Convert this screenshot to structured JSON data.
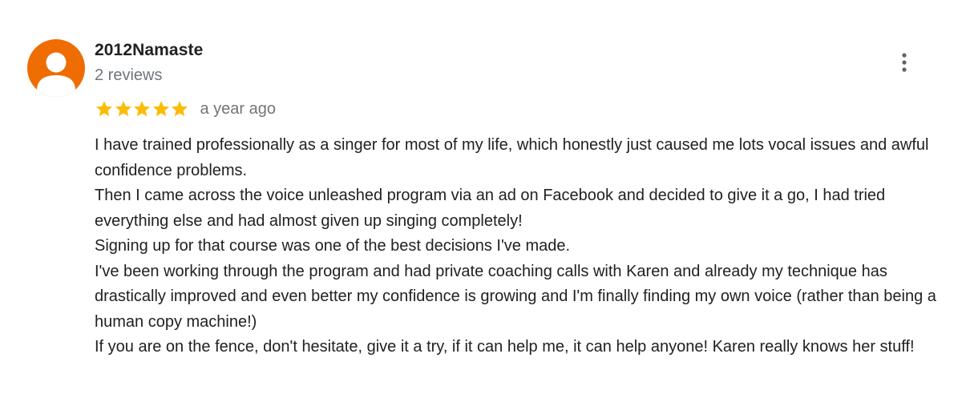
{
  "review": {
    "author": {
      "name": "2012Namaste",
      "meta": "2 reviews",
      "avatar_icon": "person-silhouette-icon",
      "avatar_color": "#ef6c00"
    },
    "rating": {
      "stars": 5,
      "max_stars": 5,
      "star_color": "#fbbc04"
    },
    "date": "a year ago",
    "more_icon": "more-vert-icon",
    "paragraphs": [
      "I have trained professionally as a singer for most of my life, which honestly just caused me lots vocal issues and awful confidence problems.",
      "Then I came across the voice unleashed program via an ad on Facebook and decided to give it a go, I had tried everything else and had almost given up singing completely!",
      "Signing up for that course was one of the best decisions I've made.",
      "I've been working through the program and had private coaching calls with Karen and already my technique has drastically improved and even better my confidence is growing and I'm finally finding my own voice (rather than being a human copy machine!)",
      "If you are on the fence, don't hesitate, give it a try, if it can help me, it can help anyone! Karen really knows her stuff!"
    ]
  }
}
